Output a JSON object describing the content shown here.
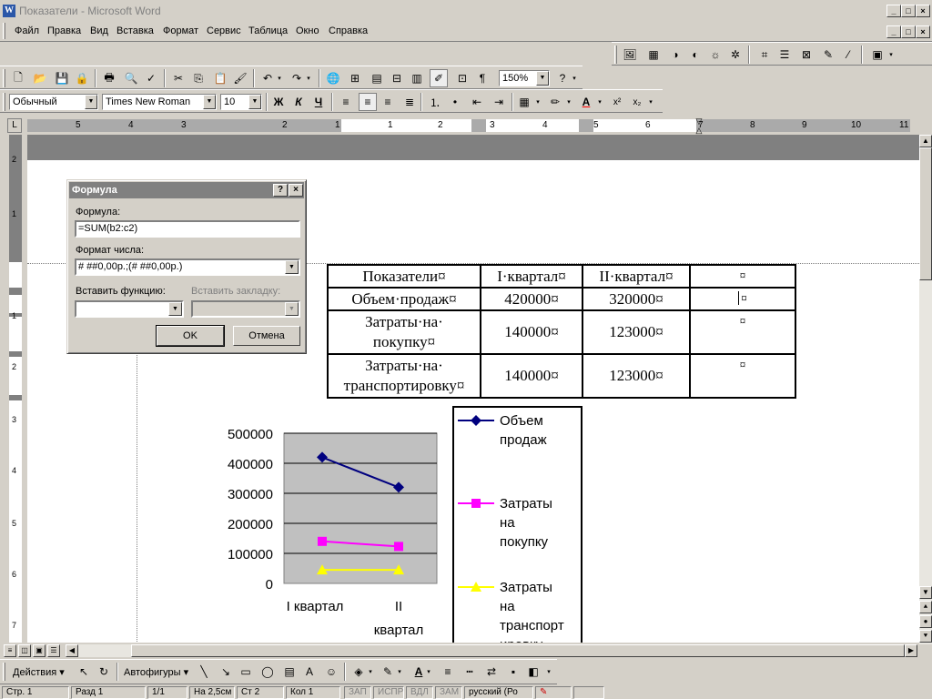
{
  "window": {
    "title": "Показатели - Microsoft Word",
    "icon_letter": "W"
  },
  "menu": [
    "Файл",
    "Правка",
    "Вид",
    "Вставка",
    "Формат",
    "Сервис",
    "Таблица",
    "Окно",
    "Справка"
  ],
  "standard_toolbar": {
    "zoom": "150%"
  },
  "formatting_toolbar": {
    "style": "Обычный",
    "font": "Times New Roman",
    "size": "10",
    "bold": "Ж",
    "italic": "К",
    "underline": "Ч"
  },
  "ruler": {
    "h_marks": [
      "5",
      "4",
      "3",
      "2",
      "1",
      "1",
      "2",
      "3",
      "4",
      "5",
      "6",
      "7",
      "8",
      "9",
      "10",
      "11"
    ],
    "v_marks": [
      "2",
      "1",
      "1",
      "2",
      "3",
      "4",
      "5",
      "6",
      "7"
    ]
  },
  "dialog": {
    "title": "Формула",
    "help_btn": "?",
    "close_btn": "×",
    "formula_label": "Формула:",
    "formula_value": "=SUM(b2:c2)",
    "format_label": "Формат числа:",
    "format_value": "# ##0,00р.;(# ##0,00р.)",
    "insert_function_label": "Вставить функцию:",
    "insert_bookmark_label": "Вставить закладку:",
    "ok": "OK",
    "cancel": "Отмена"
  },
  "table": {
    "rows": [
      [
        "Показатели¤",
        "I·квартал¤",
        "II·квартал¤",
        "¤"
      ],
      [
        "Объем·продаж¤",
        "420000¤",
        "320000¤",
        "¤"
      ],
      [
        "Затраты·на·\nпокупку¤",
        "140000¤",
        "123000¤",
        "¤"
      ],
      [
        "Затраты·на·\nтранспортировку¤",
        "140000¤",
        "123000¤",
        "¤"
      ]
    ]
  },
  "chart_data": {
    "type": "line",
    "categories": [
      "I квартал",
      "II квартал"
    ],
    "series": [
      {
        "name": "Объем продаж",
        "values": [
          420000,
          320000
        ],
        "color": "#00007f",
        "marker": "diamond"
      },
      {
        "name": "Затраты на покупку",
        "values": [
          140000,
          123000
        ],
        "color": "#ff00ff",
        "marker": "square"
      },
      {
        "name": "Затраты на транспортировку",
        "values": [
          45000,
          45000
        ],
        "color": "#ffff00",
        "marker": "triangle"
      }
    ],
    "ylim": [
      0,
      500000
    ],
    "yticks": [
      "500000",
      "400000",
      "300000",
      "200000",
      "100000",
      "0"
    ],
    "x_labels": [
      "I квартал",
      "II",
      "квартал"
    ],
    "plot_background": "#c0c0c0",
    "grid": true,
    "legend_position": "right",
    "legend_lines": [
      [
        "Объем",
        "продаж"
      ],
      [
        "Затраты",
        "на",
        "покупку"
      ],
      [
        "Затраты",
        "на",
        "транспорт",
        "ировку"
      ]
    ]
  },
  "drawing_toolbar": {
    "actions": "Действия",
    "autoshapes": "Автофигуры"
  },
  "status": {
    "page": "Стр. 1",
    "section": "Разд 1",
    "pages": "1/1",
    "at": "На 2,5см",
    "line": "Ст 2",
    "col": "Кол 1",
    "rec": "ЗАП",
    "trk": "ИСПР",
    "ext": "ВДЛ",
    "ovr": "ЗАМ",
    "lang": "русский (Ро"
  }
}
